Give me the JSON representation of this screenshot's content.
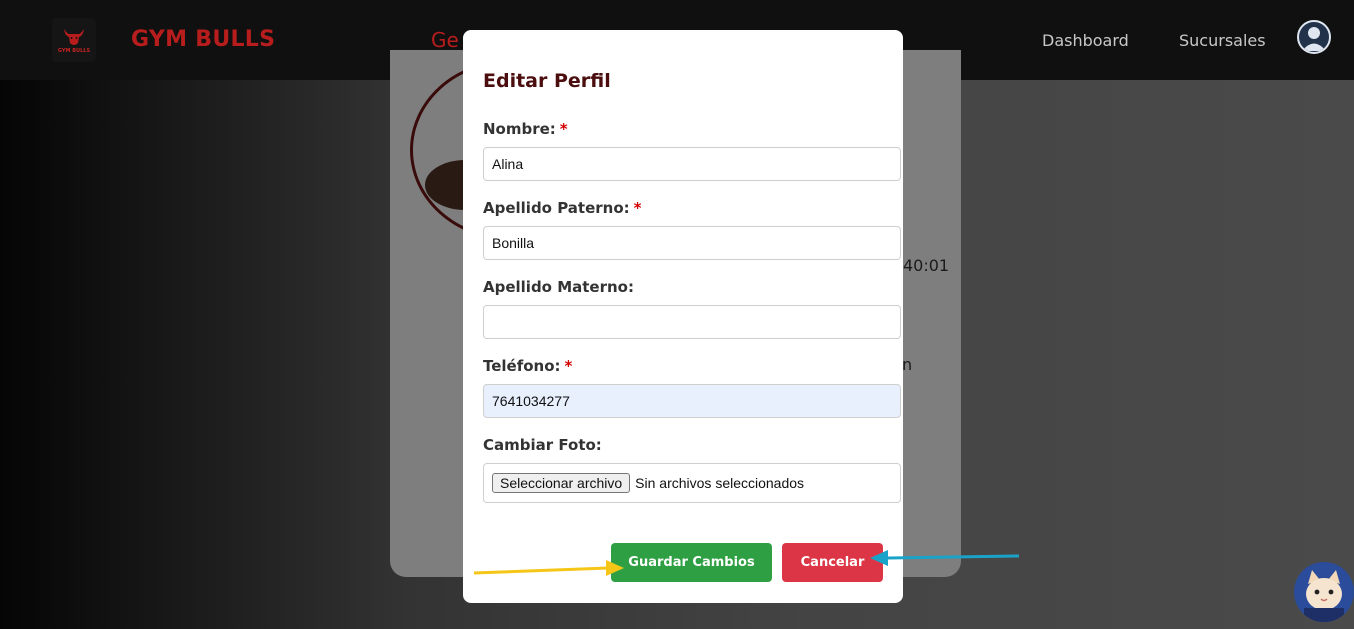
{
  "navbar": {
    "brand": "GYM BULLS",
    "logo_text": "GYM BULLS",
    "center_partial": "Ge",
    "links": [
      "Dashboard",
      "Sucursales"
    ]
  },
  "background": {
    "partial_time": "40:01",
    "partial_char": "n"
  },
  "modal": {
    "title": "Editar Perfil",
    "fields": [
      {
        "label": "Nombre:",
        "required": "*",
        "value": "Alina"
      },
      {
        "label": "Apellido Paterno:",
        "required": "*",
        "value": "Bonilla"
      },
      {
        "label": "Apellido Materno:",
        "required": "",
        "value": ""
      },
      {
        "label": "Teléfono:",
        "required": "*",
        "value": "7641034277"
      }
    ],
    "file": {
      "label": "Cambiar Foto:",
      "button": "Seleccionar archivo",
      "status": "Sin archivos seleccionados"
    },
    "buttons": {
      "save": "Guardar Cambios",
      "cancel": "Cancelar"
    }
  },
  "colors": {
    "brand": "#b81d1d",
    "title": "#4b0d0d",
    "save": "#2ea043",
    "cancel": "#dc3545",
    "arrow_yellow": "#f5c518",
    "arrow_blue": "#1aa3c8"
  }
}
